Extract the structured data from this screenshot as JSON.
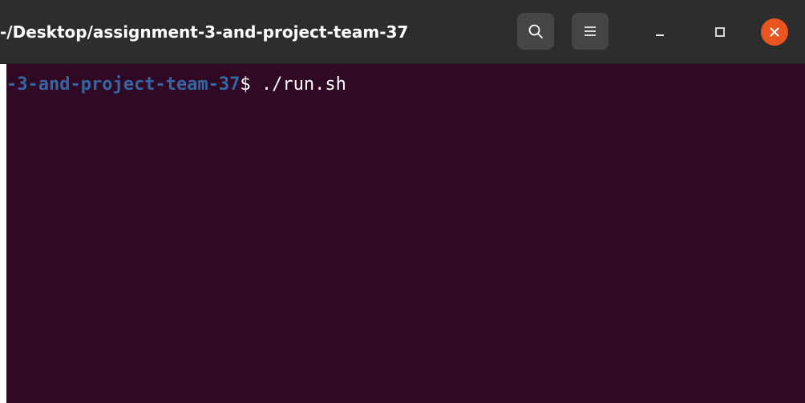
{
  "titlebar": {
    "title": "-/Desktop/assignment-3-and-project-team-37"
  },
  "icons": {
    "search": "search-icon",
    "menu": "hamburger-menu-icon",
    "minimize": "minimize-icon",
    "maximize": "maximize-icon",
    "close": "close-icon"
  },
  "terminal": {
    "prompt_path": "-3-and-project-team-37",
    "prompt_symbol": "$",
    "command": " ./run.sh"
  },
  "colors": {
    "titlebar_bg": "#2d2d2d",
    "button_bg": "#454545",
    "close_accent": "#e95420",
    "terminal_bg": "#300a24",
    "prompt_path": "#3465a4",
    "text": "#ffffff"
  }
}
